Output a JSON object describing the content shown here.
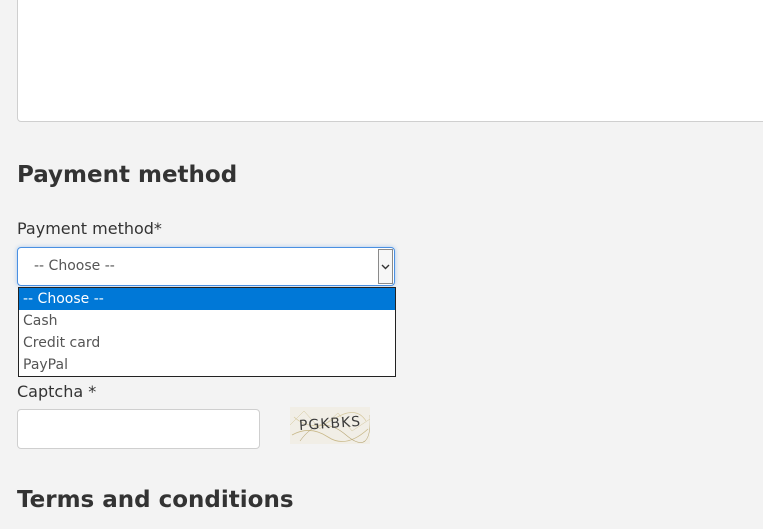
{
  "payment_section": {
    "heading": "Payment method",
    "field_label": "Payment method*",
    "select": {
      "selected_value": "-- Choose --",
      "options": [
        "-- Choose --",
        "Cash",
        "Credit card",
        "PayPal"
      ],
      "highlighted_index": 0
    }
  },
  "captcha": {
    "label": "Captcha *",
    "input_value": "",
    "image_text": "PGKBKS"
  },
  "terms_section": {
    "heading": "Terms and conditions"
  },
  "colors": {
    "background": "#f3f3f3",
    "focus_border": "#4a90e2",
    "option_highlight": "#0078d7",
    "text": "#333333"
  },
  "icons": {
    "select_arrow": "chevron-down-icon"
  }
}
